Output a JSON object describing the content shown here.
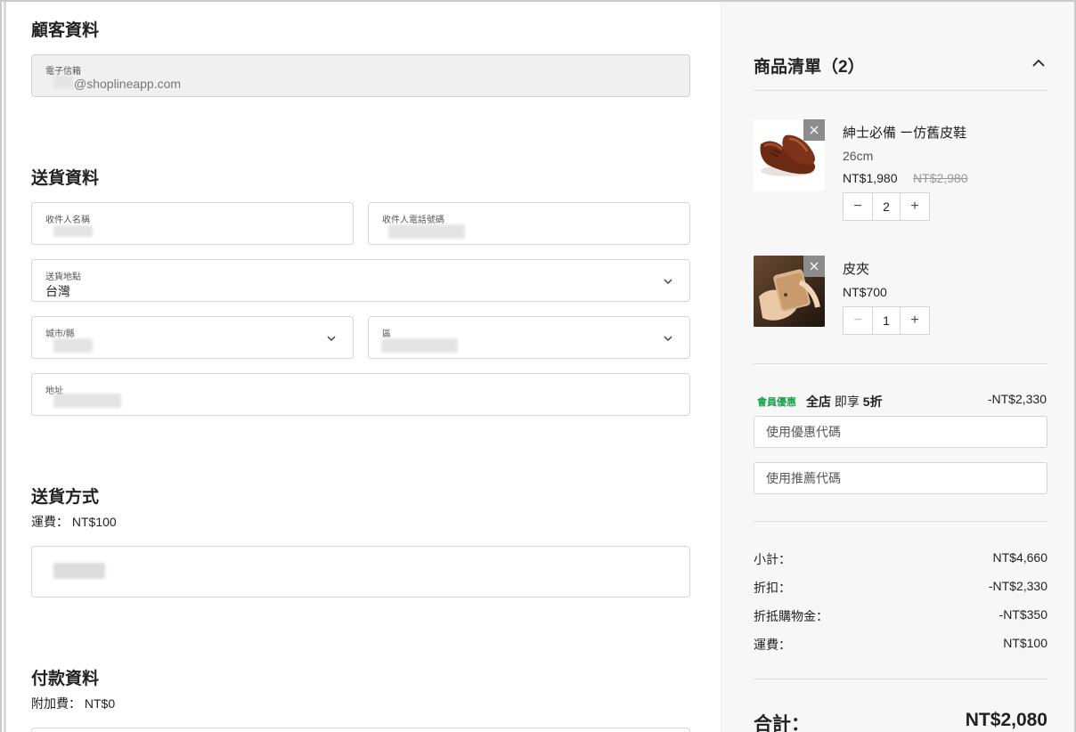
{
  "customer": {
    "title": "顧客資料",
    "email_label": "電子信箱",
    "email_value": "@shoplineapp.com"
  },
  "delivery": {
    "title": "送貨資料",
    "recipient_name_label": "收件人名稱",
    "recipient_phone_label": "收件人電話號碼",
    "location_label": "送貨地點",
    "location_value": "台灣",
    "city_label": "城市/縣",
    "district_label": "區",
    "address_label": "地址"
  },
  "shipping": {
    "title": "送貨方式",
    "fee_text": "運費： NT$100"
  },
  "payment": {
    "title": "付款資料",
    "surcharge_text": "附加費： NT$0"
  },
  "cart": {
    "title": "商品清單（2）",
    "items": [
      {
        "name": "紳士必備 ー仿舊皮鞋",
        "variant": "26cm",
        "price": "NT$1,980",
        "original_price": "NT$2,980",
        "qty": "2",
        "remove_icon": "close-icon"
      },
      {
        "name": "皮夾",
        "price": "NT$700",
        "qty": "1",
        "remove_icon": "close-icon"
      }
    ],
    "promo": {
      "tag": "會員優惠",
      "text_prefix": "全店",
      "text_middle": "即享",
      "text_suffix": "5折",
      "amount": "-NT$2,330"
    },
    "coupon_placeholder": "使用優惠代碼",
    "referral_placeholder": "使用推薦代碼",
    "summary": [
      {
        "label": "小計：",
        "value": "NT$4,660"
      },
      {
        "label": "折扣：",
        "value": "-NT$2,330"
      },
      {
        "label": "折抵購物金：",
        "value": "-NT$350"
      },
      {
        "label": "運費：",
        "value": "NT$100"
      }
    ],
    "total_label": "合計：",
    "total_value": "NT$2,080"
  },
  "colors": {
    "promo_green": "#17a34a",
    "sidebar_bg": "#f7f7f7",
    "disabled_field_bg": "#f0f0f0"
  }
}
